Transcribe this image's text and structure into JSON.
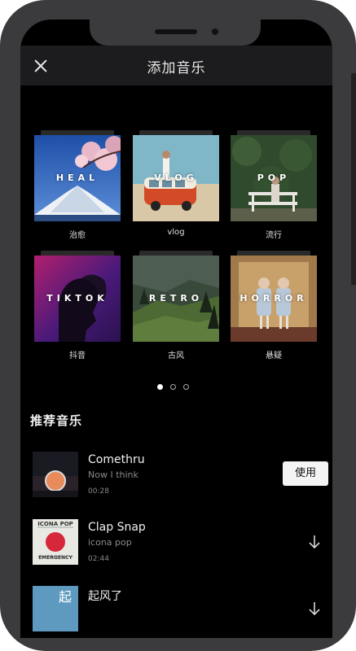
{
  "header": {
    "title": "添加音乐"
  },
  "categories": [
    {
      "tag": "HEAL",
      "caption": "治愈"
    },
    {
      "tag": "VLOG",
      "caption": "vlog"
    },
    {
      "tag": "POP",
      "caption": "流行"
    },
    {
      "tag": "TIKTOK",
      "caption": "抖音"
    },
    {
      "tag": "RETRO",
      "caption": "古风"
    },
    {
      "tag": "HORROR",
      "caption": "悬疑"
    }
  ],
  "pagination": {
    "pages": 3,
    "active": 1
  },
  "recommend": {
    "title": "推荐音乐",
    "tracks": [
      {
        "name": "Comethru",
        "artist": "Now I think",
        "duration": "00:28",
        "action": "使用"
      },
      {
        "name": "Clap Snap",
        "artist": "icona pop",
        "duration": "02:44",
        "album_text": "ICONA POP",
        "album_text2": "EMERGENCY"
      },
      {
        "name": "起风了",
        "artist": "",
        "duration": "",
        "album_text": "起"
      }
    ]
  },
  "colors": {
    "background": "#000000",
    "header": "#1c1c1e",
    "phone_frame": "#3b3b3d",
    "button": "#f4f4f4"
  },
  "icons": {
    "close": "close-icon",
    "download": "download-arrow-icon"
  }
}
